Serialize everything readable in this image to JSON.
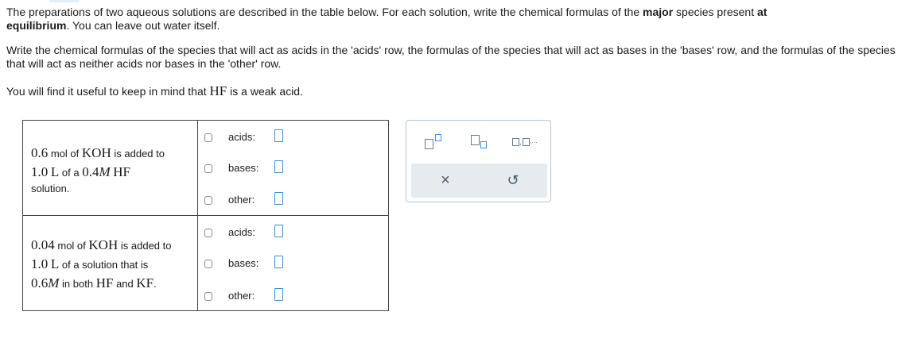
{
  "intro": {
    "p1_a": "The preparations of two aqueous solutions are described in the table below. For each solution, write the chemical formulas of the",
    "p1_bold1": "major",
    "p1_b": "species present",
    "p1_bold2": "at",
    "p1_bold3": "equilibrium",
    "p1_c": ". You can leave out water itself.",
    "p2": "Write the chemical formulas of the species that will act as acids in the 'acids' row, the formulas of the species that will act as bases in the 'bases' row, and the formulas of the species that will act as neither acids nor bases in the 'other' row.",
    "p3_a": "You will find it useful to keep in mind that",
    "p3_hf": "HF",
    "p3_b": "is a weak acid."
  },
  "questions": [
    {
      "desc": {
        "amount": "0.6",
        "unit1": "mol of",
        "koh": "KOH",
        "mid": "is added to",
        "vol": "1.0",
        "L": "L",
        "ofa": "of a",
        "conc": "0.4",
        "M": "M",
        "hf": "HF",
        "end": "solution."
      },
      "rows": [
        {
          "label": "acids:"
        },
        {
          "label": "bases:"
        },
        {
          "label": "other:"
        }
      ]
    },
    {
      "desc": {
        "amount": "0.04",
        "unit1": "mol of",
        "koh": "KOH",
        "mid": "is added to",
        "vol": "1.0",
        "L": "L",
        "ofa": "of a solution that is",
        "conc": "0.6",
        "M": "M",
        "inboth": "in both",
        "hf": "HF",
        "and": "and",
        "kf": "KF",
        "period": "."
      },
      "rows": [
        {
          "label": "acids:"
        },
        {
          "label": "bases:"
        },
        {
          "label": "other:"
        }
      ]
    }
  ],
  "toolbox": {
    "ellipsis": ",...",
    "clear_symbol": "×",
    "undo_symbol": "↺"
  }
}
